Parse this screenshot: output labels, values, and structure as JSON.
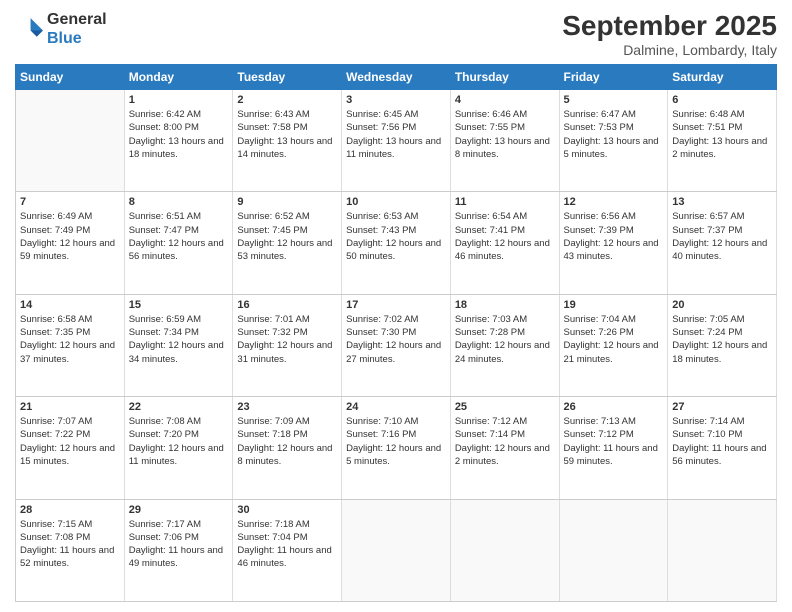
{
  "header": {
    "logo_line1": "General",
    "logo_line2": "Blue",
    "month": "September 2025",
    "location": "Dalmine, Lombardy, Italy"
  },
  "weekdays": [
    "Sunday",
    "Monday",
    "Tuesday",
    "Wednesday",
    "Thursday",
    "Friday",
    "Saturday"
  ],
  "weeks": [
    [
      {
        "day": "",
        "sunrise": "",
        "sunset": "",
        "daylight": ""
      },
      {
        "day": "1",
        "sunrise": "Sunrise: 6:42 AM",
        "sunset": "Sunset: 8:00 PM",
        "daylight": "Daylight: 13 hours and 18 minutes."
      },
      {
        "day": "2",
        "sunrise": "Sunrise: 6:43 AM",
        "sunset": "Sunset: 7:58 PM",
        "daylight": "Daylight: 13 hours and 14 minutes."
      },
      {
        "day": "3",
        "sunrise": "Sunrise: 6:45 AM",
        "sunset": "Sunset: 7:56 PM",
        "daylight": "Daylight: 13 hours and 11 minutes."
      },
      {
        "day": "4",
        "sunrise": "Sunrise: 6:46 AM",
        "sunset": "Sunset: 7:55 PM",
        "daylight": "Daylight: 13 hours and 8 minutes."
      },
      {
        "day": "5",
        "sunrise": "Sunrise: 6:47 AM",
        "sunset": "Sunset: 7:53 PM",
        "daylight": "Daylight: 13 hours and 5 minutes."
      },
      {
        "day": "6",
        "sunrise": "Sunrise: 6:48 AM",
        "sunset": "Sunset: 7:51 PM",
        "daylight": "Daylight: 13 hours and 2 minutes."
      }
    ],
    [
      {
        "day": "7",
        "sunrise": "Sunrise: 6:49 AM",
        "sunset": "Sunset: 7:49 PM",
        "daylight": "Daylight: 12 hours and 59 minutes."
      },
      {
        "day": "8",
        "sunrise": "Sunrise: 6:51 AM",
        "sunset": "Sunset: 7:47 PM",
        "daylight": "Daylight: 12 hours and 56 minutes."
      },
      {
        "day": "9",
        "sunrise": "Sunrise: 6:52 AM",
        "sunset": "Sunset: 7:45 PM",
        "daylight": "Daylight: 12 hours and 53 minutes."
      },
      {
        "day": "10",
        "sunrise": "Sunrise: 6:53 AM",
        "sunset": "Sunset: 7:43 PM",
        "daylight": "Daylight: 12 hours and 50 minutes."
      },
      {
        "day": "11",
        "sunrise": "Sunrise: 6:54 AM",
        "sunset": "Sunset: 7:41 PM",
        "daylight": "Daylight: 12 hours and 46 minutes."
      },
      {
        "day": "12",
        "sunrise": "Sunrise: 6:56 AM",
        "sunset": "Sunset: 7:39 PM",
        "daylight": "Daylight: 12 hours and 43 minutes."
      },
      {
        "day": "13",
        "sunrise": "Sunrise: 6:57 AM",
        "sunset": "Sunset: 7:37 PM",
        "daylight": "Daylight: 12 hours and 40 minutes."
      }
    ],
    [
      {
        "day": "14",
        "sunrise": "Sunrise: 6:58 AM",
        "sunset": "Sunset: 7:35 PM",
        "daylight": "Daylight: 12 hours and 37 minutes."
      },
      {
        "day": "15",
        "sunrise": "Sunrise: 6:59 AM",
        "sunset": "Sunset: 7:34 PM",
        "daylight": "Daylight: 12 hours and 34 minutes."
      },
      {
        "day": "16",
        "sunrise": "Sunrise: 7:01 AM",
        "sunset": "Sunset: 7:32 PM",
        "daylight": "Daylight: 12 hours and 31 minutes."
      },
      {
        "day": "17",
        "sunrise": "Sunrise: 7:02 AM",
        "sunset": "Sunset: 7:30 PM",
        "daylight": "Daylight: 12 hours and 27 minutes."
      },
      {
        "day": "18",
        "sunrise": "Sunrise: 7:03 AM",
        "sunset": "Sunset: 7:28 PM",
        "daylight": "Daylight: 12 hours and 24 minutes."
      },
      {
        "day": "19",
        "sunrise": "Sunrise: 7:04 AM",
        "sunset": "Sunset: 7:26 PM",
        "daylight": "Daylight: 12 hours and 21 minutes."
      },
      {
        "day": "20",
        "sunrise": "Sunrise: 7:05 AM",
        "sunset": "Sunset: 7:24 PM",
        "daylight": "Daylight: 12 hours and 18 minutes."
      }
    ],
    [
      {
        "day": "21",
        "sunrise": "Sunrise: 7:07 AM",
        "sunset": "Sunset: 7:22 PM",
        "daylight": "Daylight: 12 hours and 15 minutes."
      },
      {
        "day": "22",
        "sunrise": "Sunrise: 7:08 AM",
        "sunset": "Sunset: 7:20 PM",
        "daylight": "Daylight: 12 hours and 11 minutes."
      },
      {
        "day": "23",
        "sunrise": "Sunrise: 7:09 AM",
        "sunset": "Sunset: 7:18 PM",
        "daylight": "Daylight: 12 hours and 8 minutes."
      },
      {
        "day": "24",
        "sunrise": "Sunrise: 7:10 AM",
        "sunset": "Sunset: 7:16 PM",
        "daylight": "Daylight: 12 hours and 5 minutes."
      },
      {
        "day": "25",
        "sunrise": "Sunrise: 7:12 AM",
        "sunset": "Sunset: 7:14 PM",
        "daylight": "Daylight: 12 hours and 2 minutes."
      },
      {
        "day": "26",
        "sunrise": "Sunrise: 7:13 AM",
        "sunset": "Sunset: 7:12 PM",
        "daylight": "Daylight: 11 hours and 59 minutes."
      },
      {
        "day": "27",
        "sunrise": "Sunrise: 7:14 AM",
        "sunset": "Sunset: 7:10 PM",
        "daylight": "Daylight: 11 hours and 56 minutes."
      }
    ],
    [
      {
        "day": "28",
        "sunrise": "Sunrise: 7:15 AM",
        "sunset": "Sunset: 7:08 PM",
        "daylight": "Daylight: 11 hours and 52 minutes."
      },
      {
        "day": "29",
        "sunrise": "Sunrise: 7:17 AM",
        "sunset": "Sunset: 7:06 PM",
        "daylight": "Daylight: 11 hours and 49 minutes."
      },
      {
        "day": "30",
        "sunrise": "Sunrise: 7:18 AM",
        "sunset": "Sunset: 7:04 PM",
        "daylight": "Daylight: 11 hours and 46 minutes."
      },
      {
        "day": "",
        "sunrise": "",
        "sunset": "",
        "daylight": ""
      },
      {
        "day": "",
        "sunrise": "",
        "sunset": "",
        "daylight": ""
      },
      {
        "day": "",
        "sunrise": "",
        "sunset": "",
        "daylight": ""
      },
      {
        "day": "",
        "sunrise": "",
        "sunset": "",
        "daylight": ""
      }
    ]
  ]
}
